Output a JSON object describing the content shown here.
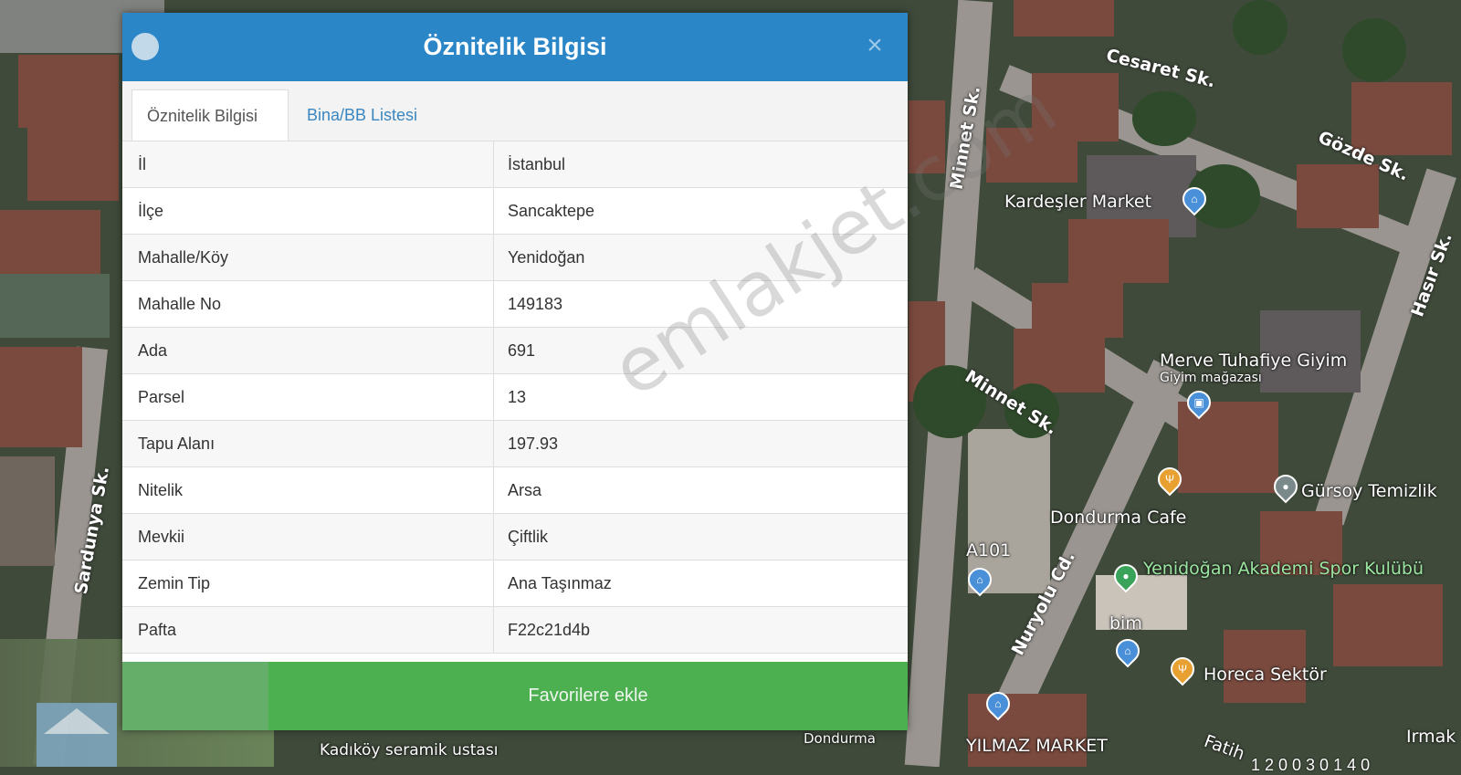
{
  "modal": {
    "title": "Öznitelik Bilgisi",
    "close_symbol": "×",
    "tabs": [
      {
        "label": "Öznitelik Bilgisi",
        "active": true
      },
      {
        "label": "Bina/BB Listesi",
        "active": false
      }
    ],
    "rows": [
      {
        "key": "İl",
        "value": "İstanbul"
      },
      {
        "key": "İlçe",
        "value": "Sancaktepe"
      },
      {
        "key": "Mahalle/Köy",
        "value": "Yenidoğan"
      },
      {
        "key": "Mahalle No",
        "value": "149183"
      },
      {
        "key": "Ada",
        "value": "691"
      },
      {
        "key": "Parsel",
        "value": "13"
      },
      {
        "key": "Tapu Alanı",
        "value": "197.93"
      },
      {
        "key": "Nitelik",
        "value": "Arsa"
      },
      {
        "key": "Mevkii",
        "value": "Çiftlik"
      },
      {
        "key": "Zemin Tip",
        "value": "Ana Taşınmaz"
      },
      {
        "key": "Pafta",
        "value": "F22c21d4b"
      }
    ],
    "favorite_button": "Favorilere ekle"
  },
  "watermark": "emlakjet.com",
  "map": {
    "streets": [
      "Cesaret Sk.",
      "Gözde Sk.",
      "Minnet Sk.",
      "Minnet Sk.",
      "Hasır Sk.",
      "Sardunya Sk.",
      "Nuryolu Cd."
    ],
    "pois": [
      {
        "label": "Kardeşler Market",
        "icon": "shopping-basket-icon",
        "color": "#4a90d9"
      },
      {
        "label": "Merve Tuhafiye Giyim",
        "sub": "Giyim mağazası",
        "icon": "shopping-bag-icon",
        "color": "#4a90d9"
      },
      {
        "label": "Gürsoy Temizlik",
        "icon": "place-icon",
        "color": "#7a8a8a"
      },
      {
        "label": "Dondurma Cafe",
        "icon": "restaurant-icon",
        "color": "#e8a030"
      },
      {
        "label": "A101",
        "icon": "shopping-basket-icon",
        "color": "#4a90d9"
      },
      {
        "label": "Yenidoğan Akademi Spor Kulübü",
        "icon": "place-icon",
        "color": "#3aa35a"
      },
      {
        "label": "bim",
        "icon": "shopping-basket-icon",
        "color": "#4a90d9"
      },
      {
        "label": "Horeca Sektör",
        "icon": "restaurant-icon",
        "color": "#e8a030"
      },
      {
        "label": "YILMAZ MARKET",
        "icon": "shopping-basket-icon",
        "color": "#4a90d9"
      },
      {
        "label": "Kadıköy seramik ustası"
      },
      {
        "label": "Dondurma"
      },
      {
        "label": "Fatih"
      },
      {
        "label": "Irmak"
      }
    ]
  },
  "footer_number": "1 2 0 0 3 0 1 4 0"
}
